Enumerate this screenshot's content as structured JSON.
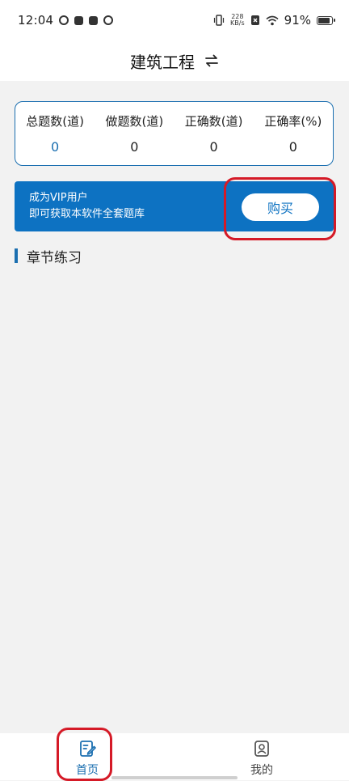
{
  "status_bar": {
    "time": "12:04",
    "net_speed_value": "228",
    "net_speed_unit": "KB/s",
    "battery": "91%"
  },
  "header": {
    "title": "建筑工程",
    "swap_icon": "swap-arrows-icon"
  },
  "stats": [
    {
      "label": "总题数(道)",
      "value": "0",
      "color": "#1b6fb0"
    },
    {
      "label": "做题数(道)",
      "value": "0"
    },
    {
      "label": "正确数(道)",
      "value": "0"
    },
    {
      "label": "正确率(%)",
      "value": "0"
    }
  ],
  "vip_banner": {
    "line1": "成为VIP用户",
    "line2": "即可获取本软件全套题库",
    "buy_label": "购买",
    "background": "#0d72c2"
  },
  "section": {
    "title": "章节练习"
  },
  "tabbar": {
    "items": [
      {
        "label": "首页",
        "icon": "edit-note-icon",
        "active": true
      },
      {
        "label": "我的",
        "icon": "profile-icon",
        "active": false
      }
    ]
  },
  "colors": {
    "accent": "#1b6fb0",
    "highlight": "#d51a27",
    "page_bg": "#f2f2f2"
  }
}
